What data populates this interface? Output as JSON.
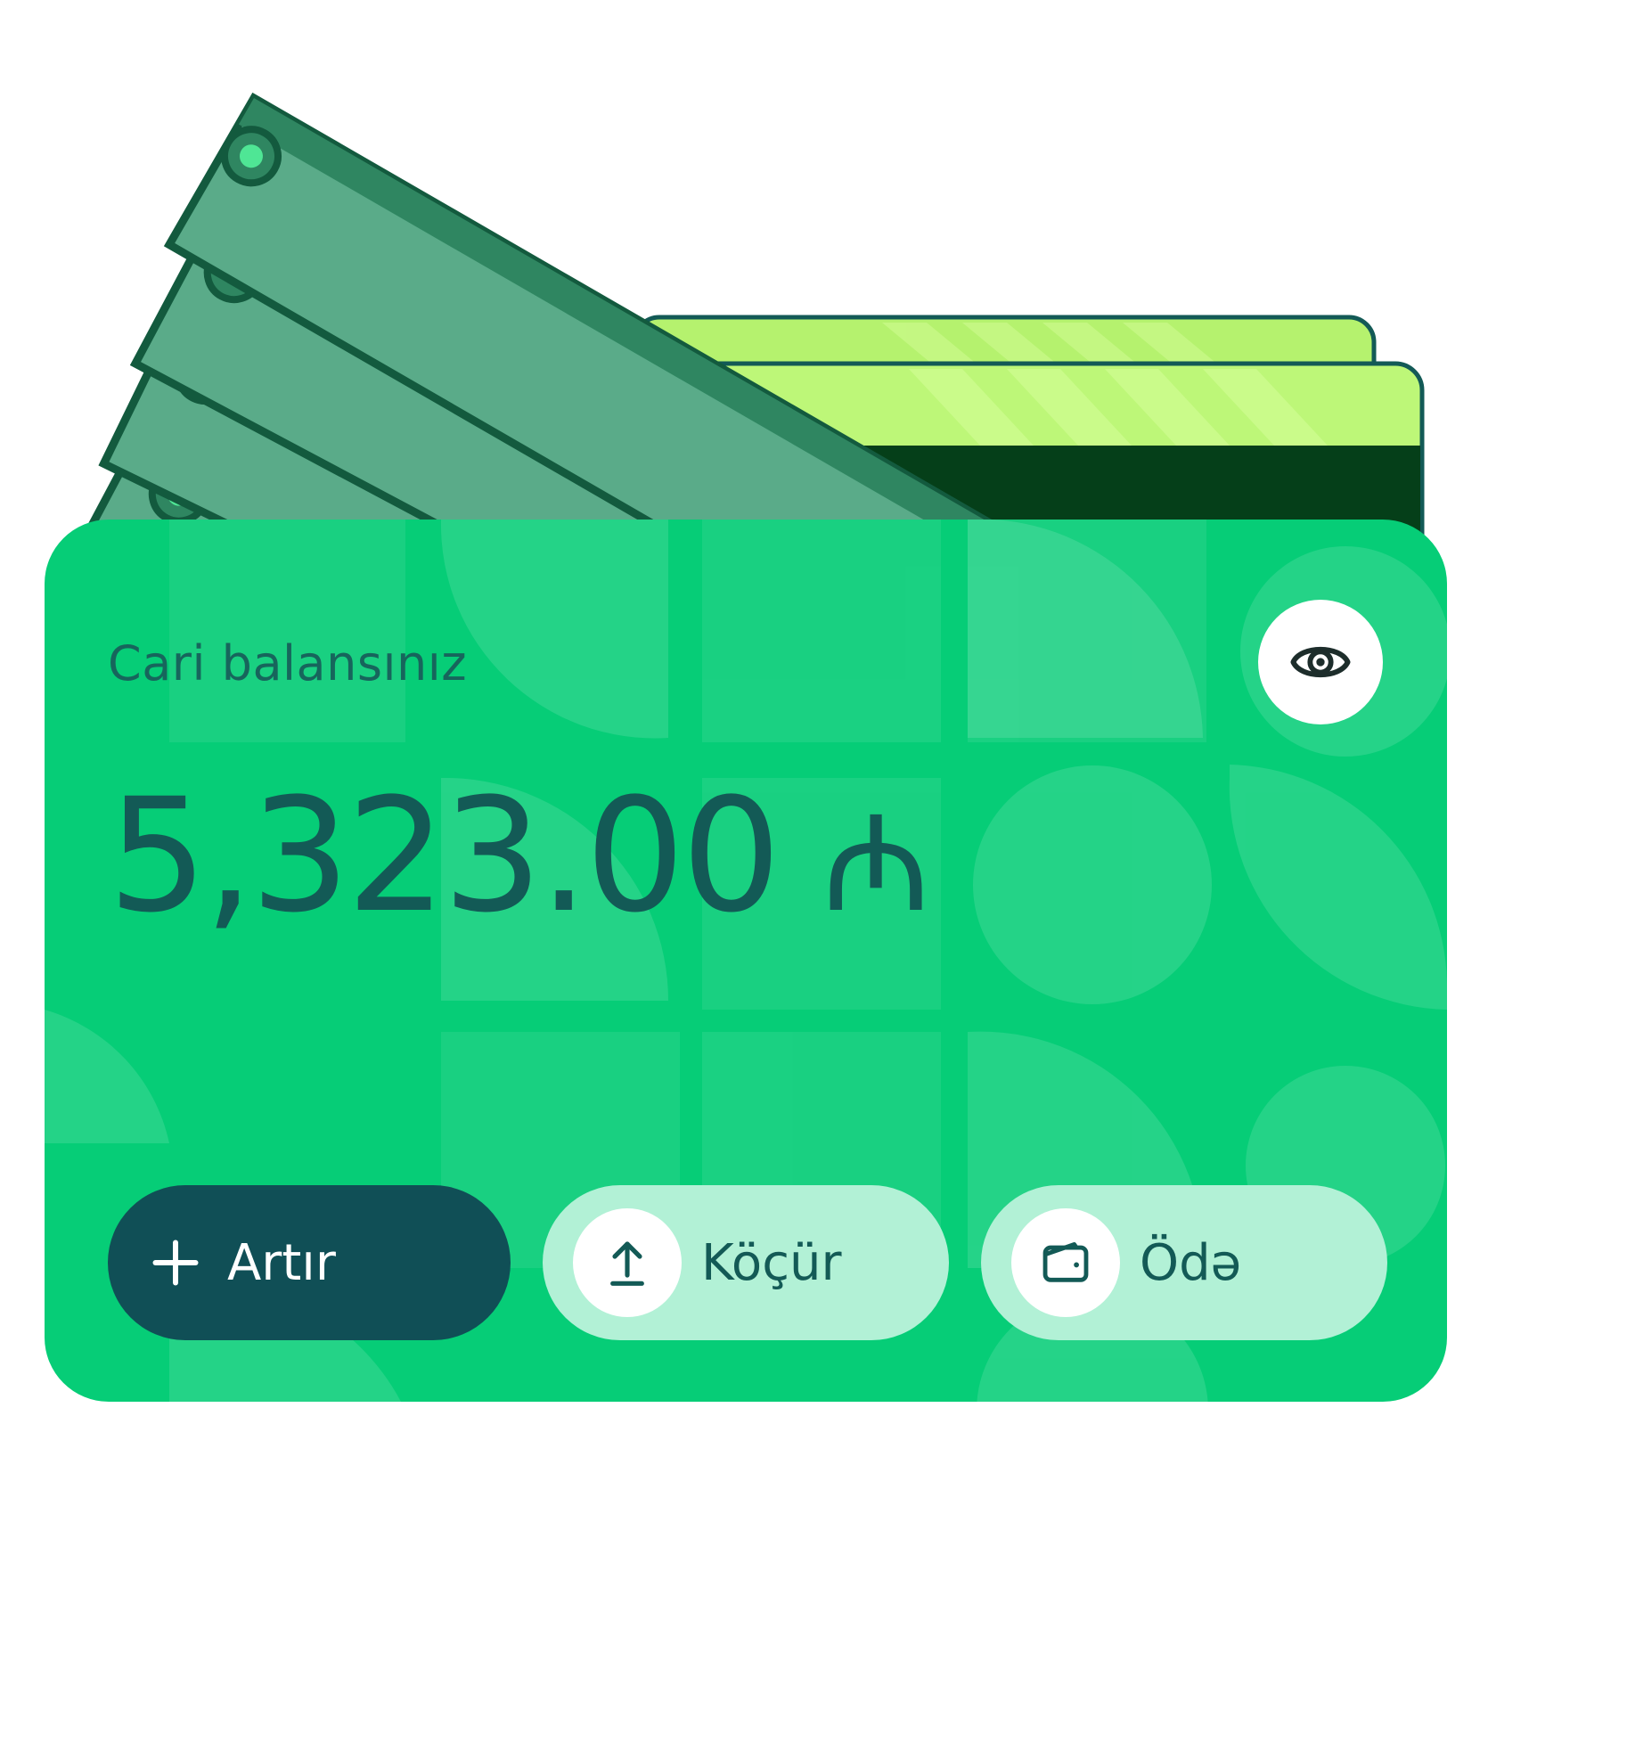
{
  "wallet": {
    "balance_label": "Cari balansınız",
    "balance_amount": "5,323.00",
    "currency_symbol": "₼",
    "visibility_icon": "eye-icon"
  },
  "actions": {
    "add_label": "Artır",
    "add_icon": "plus-icon",
    "transfer_label": "Köçür",
    "transfer_icon": "upload-arrow-icon",
    "pay_label": "Ödə",
    "pay_icon": "wallet-icon"
  },
  "colors": {
    "wallet_green": "#06cd77",
    "dark_teal": "#104f56",
    "text_teal": "#135a56",
    "light_mint": "#b2f1d6",
    "card_lime": "#c0f97c",
    "card_dark": "#053f19",
    "banknote_green": "#5aab89",
    "banknote_outline": "#135a3e"
  }
}
